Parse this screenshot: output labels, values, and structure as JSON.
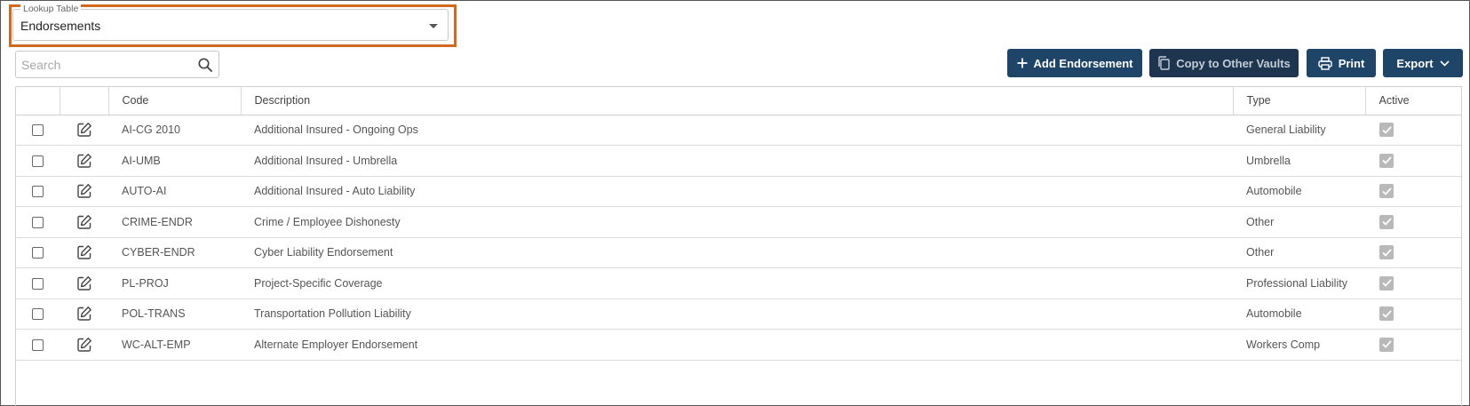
{
  "lookup": {
    "label": "Lookup Table",
    "value": "Endorsements"
  },
  "search": {
    "placeholder": "Search",
    "value": ""
  },
  "toolbar": {
    "add_label": "Add Endorsement",
    "copy_label": "Copy to Other Vaults",
    "print_label": "Print",
    "export_label": "Export"
  },
  "table": {
    "columns": [
      "",
      "",
      "Code",
      "Description",
      "Type",
      "Active"
    ],
    "rows": [
      {
        "code": "AI-CG 2010",
        "description": "Additional Insured - Ongoing Ops",
        "type": "General Liability",
        "active": true,
        "selected": false
      },
      {
        "code": "AI-UMB",
        "description": "Additional Insured - Umbrella",
        "type": "Umbrella",
        "active": true,
        "selected": false
      },
      {
        "code": "AUTO-AI",
        "description": "Additional Insured - Auto Liability",
        "type": "Automobile",
        "active": true,
        "selected": false
      },
      {
        "code": "CRIME-ENDR",
        "description": "Crime / Employee Dishonesty",
        "type": "Other",
        "active": true,
        "selected": false
      },
      {
        "code": "CYBER-ENDR",
        "description": "Cyber Liability Endorsement",
        "type": "Other",
        "active": true,
        "selected": false
      },
      {
        "code": "PL-PROJ",
        "description": "Project-Specific Coverage",
        "type": "Professional Liability",
        "active": true,
        "selected": false
      },
      {
        "code": "POL-TRANS",
        "description": "Transportation Pollution Liability",
        "type": "Automobile",
        "active": true,
        "selected": false
      },
      {
        "code": "WC-ALT-EMP",
        "description": "Alternate Employer Endorsement",
        "type": "Workers Comp",
        "active": true,
        "selected": false
      }
    ]
  },
  "colors": {
    "primary_button": "#1e4468",
    "disabled_button": "#1e3550",
    "highlight": "#d2691e"
  },
  "icons": {
    "add": "plus-icon",
    "copy": "copy-icon",
    "print": "printer-icon",
    "export": "chevron-down-icon",
    "search": "search-icon",
    "edit": "edit-icon",
    "dropdown": "caret-down-icon"
  }
}
